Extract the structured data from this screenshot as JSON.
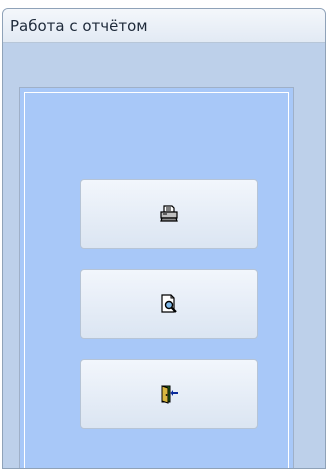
{
  "window": {
    "title": "Работа с отчётом"
  },
  "buttons": [
    {
      "icon": "printer-icon"
    },
    {
      "icon": "print-preview-icon"
    },
    {
      "icon": "exit-door-icon"
    }
  ],
  "colors": {
    "panel_background": "#a8c8f8",
    "window_background": "#bdd0ea",
    "button_face": "#e6edf7"
  }
}
